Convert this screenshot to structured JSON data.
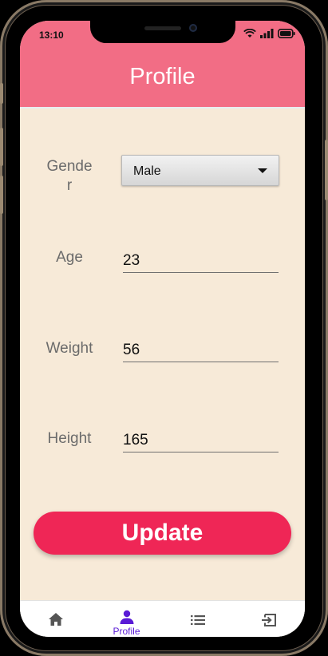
{
  "status_bar": {
    "time": "13:10"
  },
  "app_bar": {
    "title": "Profile"
  },
  "form": {
    "gender": {
      "label": "Gende\nr",
      "value": "Male"
    },
    "age": {
      "label": "Age",
      "value": "23"
    },
    "weight": {
      "label": "Weight",
      "value": "56"
    },
    "height": {
      "label": "Height",
      "value": "165"
    }
  },
  "update_button": {
    "label": "Update"
  },
  "bottom_nav": {
    "items": [
      {
        "icon": "home-icon",
        "label": ""
      },
      {
        "icon": "person-icon",
        "label": "Profile",
        "active": true
      },
      {
        "icon": "list-icon",
        "label": ""
      },
      {
        "icon": "logout-icon",
        "label": ""
      }
    ]
  },
  "colors": {
    "app_bar": "#f26d85",
    "background": "#f7ead8",
    "button": "#ef2656",
    "active_nav": "#5a1bd6"
  }
}
